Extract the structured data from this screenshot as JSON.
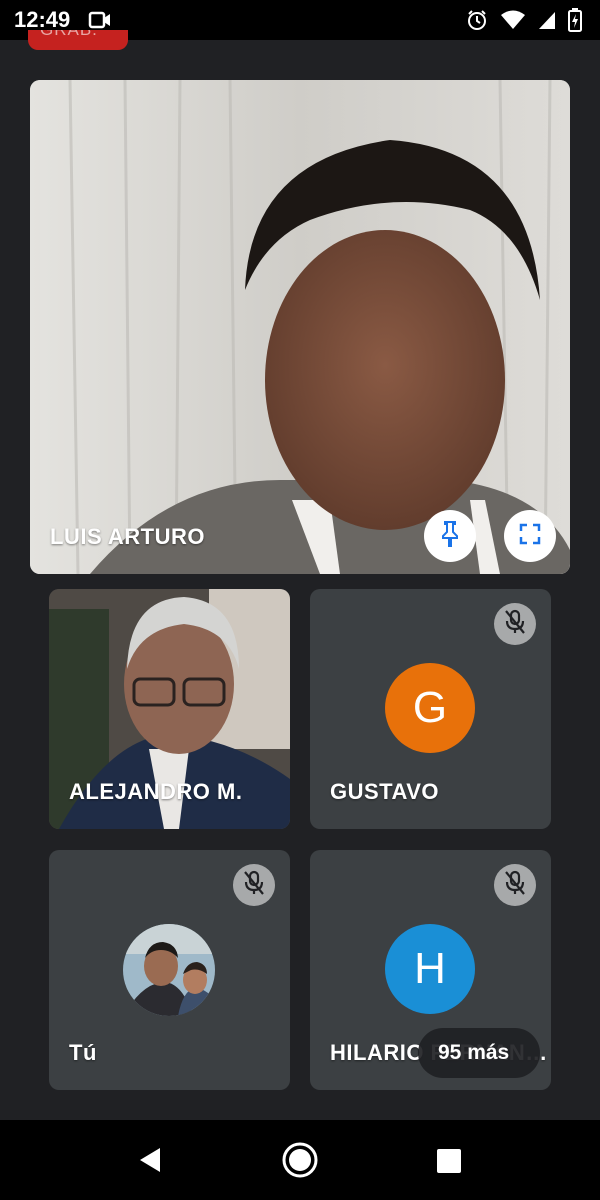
{
  "status_bar": {
    "time": "12:49",
    "icons": [
      "video-call-icon",
      "alarm-icon",
      "wifi-icon",
      "signal-icon",
      "battery-icon"
    ]
  },
  "recording_badge": {
    "label": "GRAB."
  },
  "main_tile": {
    "name": "LUIS ARTURO",
    "pin_icon": "pin-icon",
    "fullscreen_icon": "fullscreen-icon"
  },
  "participants": [
    {
      "name": "ALEJANDRO M.",
      "muted": false,
      "type": "video"
    },
    {
      "name": "GUSTAVO",
      "muted": true,
      "type": "avatar",
      "initial": "G",
      "color": "#e8710a"
    },
    {
      "name": "Tú",
      "muted": true,
      "type": "photo"
    },
    {
      "name": "HILARIO FERNAN…",
      "muted": true,
      "type": "avatar",
      "initial": "H",
      "color": "#1a8fd6"
    }
  ],
  "more_participants": {
    "label": "95 más"
  },
  "nav_bar": {
    "icons": [
      "back-icon",
      "home-icon",
      "recents-icon"
    ]
  },
  "colors": {
    "background": "#202124",
    "tile": "#3c4043",
    "accent_blue": "#1a73e8"
  }
}
